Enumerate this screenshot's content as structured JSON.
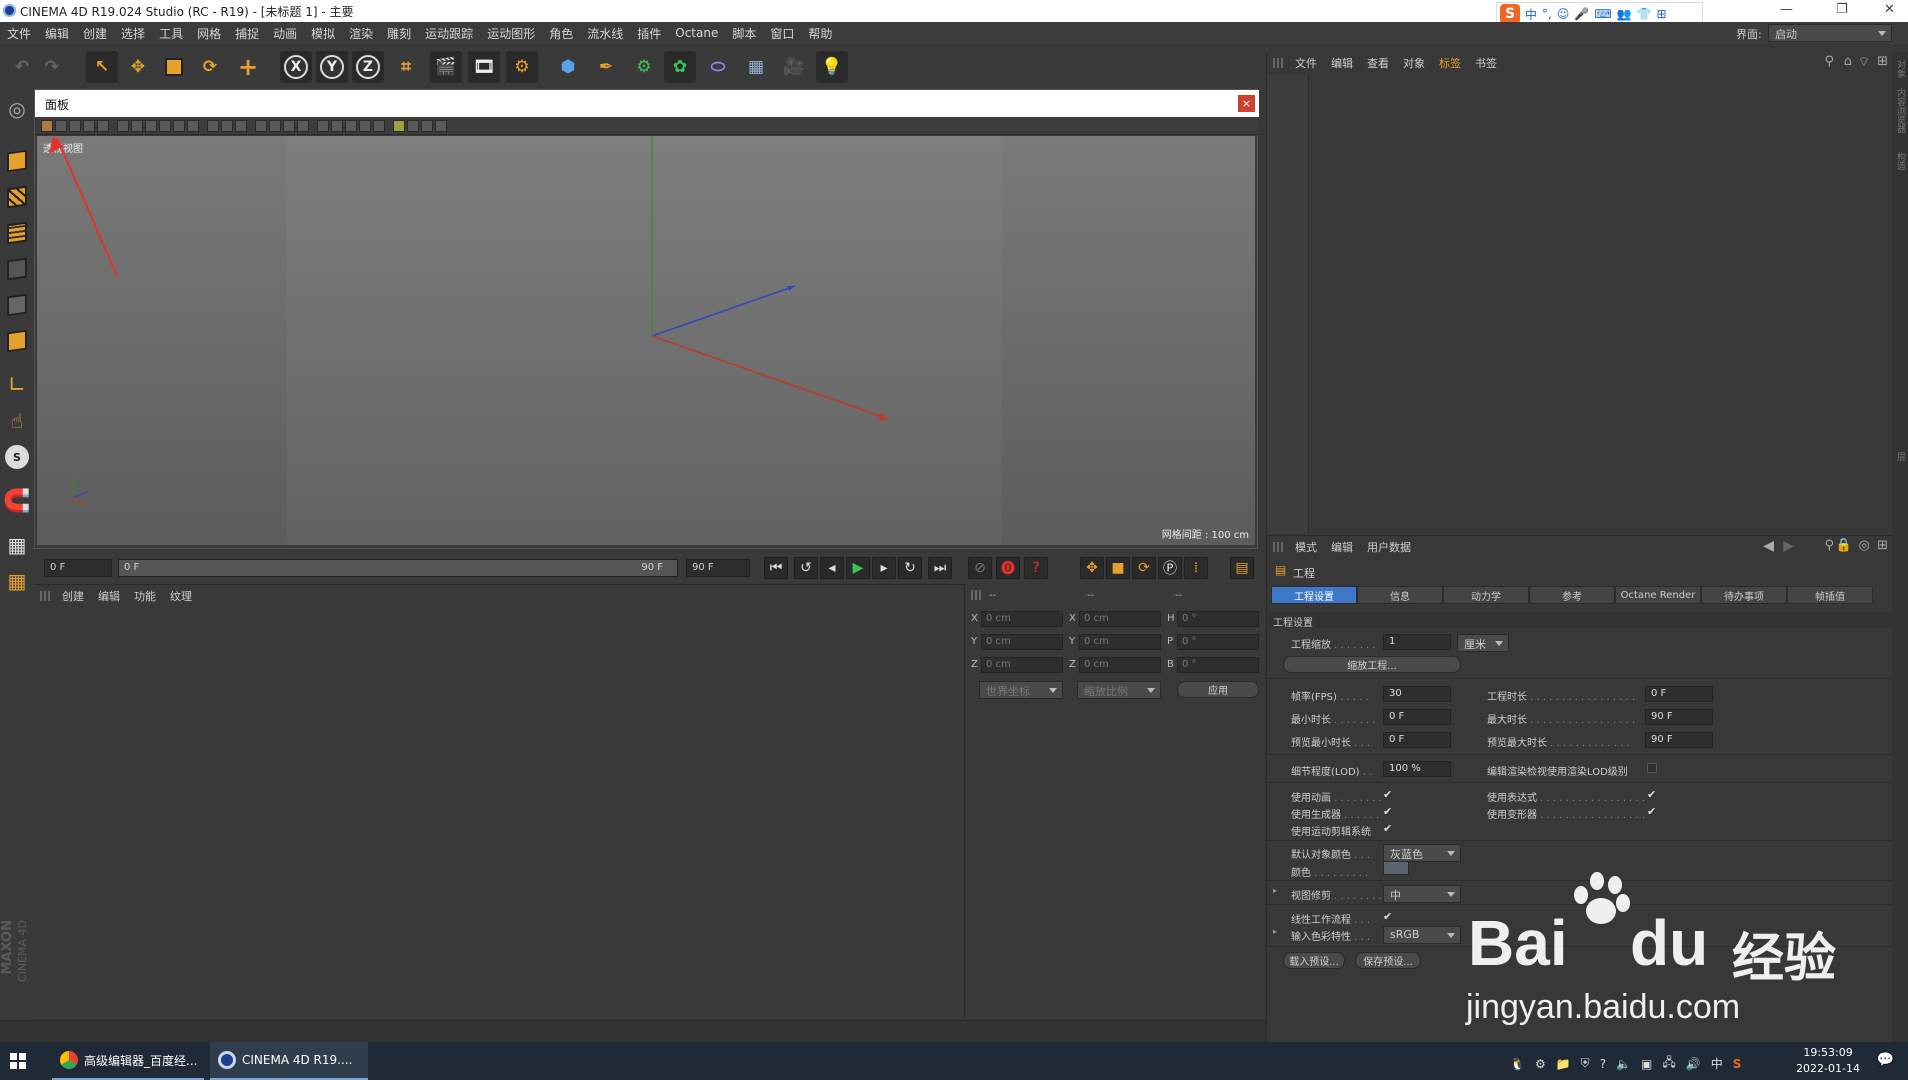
{
  "window": {
    "title": "CINEMA 4D R19.024 Studio (RC - R19) - [未标题 1] - 主要"
  },
  "ime": {
    "label": "中",
    "extras": "°,"
  },
  "menu": [
    "文件",
    "编辑",
    "创建",
    "选择",
    "工具",
    "网格",
    "捕捉",
    "动画",
    "模拟",
    "渲染",
    "雕刻",
    "运动跟踪",
    "运动图形",
    "角色",
    "流水线",
    "插件",
    "Octane",
    "脚本",
    "窗口",
    "帮助"
  ],
  "layout": {
    "label": "界面:",
    "value": "启动"
  },
  "toolbar": {
    "axis_x": "X",
    "axis_y": "Y",
    "axis_z": "Z"
  },
  "panel": {
    "title": "面板",
    "close": "×",
    "view_label": "透视视图",
    "grid_spacing": "网格间距 : 100 cm"
  },
  "timeline": {
    "current": "0 F",
    "start": "0 F",
    "end_inner": "90 F",
    "end": "90 F"
  },
  "material": {
    "menu": [
      "创建",
      "编辑",
      "功能",
      "纹理"
    ]
  },
  "coords": {
    "head": [
      "--",
      "--",
      "--"
    ],
    "rows": [
      {
        "a": "X",
        "av": "0 cm",
        "b": "X",
        "bv": "0 cm",
        "c": "H",
        "cv": "0 °"
      },
      {
        "a": "Y",
        "av": "0 cm",
        "b": "Y",
        "bv": "0 cm",
        "c": "P",
        "cv": "0 °"
      },
      {
        "a": "Z",
        "av": "0 cm",
        "b": "Z",
        "bv": "0 cm",
        "c": "B",
        "cv": "0 °"
      }
    ],
    "world": "世界坐标",
    "scale": "缩放比例",
    "apply": "应用"
  },
  "objects": {
    "menu": [
      "文件",
      "编辑",
      "查看",
      "对象",
      "标签",
      "书签"
    ]
  },
  "attributes": {
    "menu": [
      "模式",
      "编辑",
      "用户数据"
    ],
    "title": "工程",
    "tabs": [
      "工程设置",
      "信息",
      "动力学",
      "参考",
      "Octane Render",
      "待办事项",
      "帧插值"
    ],
    "section": "工程设置",
    "scale_label": "工程缩放",
    "scale_value": "1",
    "scale_unit": "厘米",
    "scale_btn": "缩放工程...",
    "fps_label": "帧率(FPS)",
    "fps": "30",
    "time_label": "工程时长",
    "time": "0 F",
    "min_label": "最小时长",
    "min": "0 F",
    "max_label": "最大时长",
    "max": "90 F",
    "pmin_label": "预览最小时长",
    "pmin": "0 F",
    "pmax_label": "预览最大时长",
    "pmax": "90 F",
    "lod_label": "细节程度(LOD)",
    "lod": "100 %",
    "lod_render_label": "编辑渲染检视使用渲染LOD级别",
    "anim_label": "使用动画",
    "expr_label": "使用表达式",
    "gen_label": "使用生成器",
    "deform_label": "使用变形器",
    "motion_label": "使用运动剪辑系统",
    "defcolor_label": "默认对象颜色",
    "defcolor": "灰蓝色",
    "color_label": "颜色",
    "clip_label": "视图修剪",
    "clip": "中",
    "linear_label": "线性工作流程",
    "input_label": "输入色彩特性",
    "input": "sRGB",
    "load": "载入预设...",
    "save": "保存预设..."
  },
  "side_tabs": [
    "对象",
    "内容浏览器",
    "构造",
    "层"
  ],
  "brand": {
    "line1": "MAXON",
    "line2": "CINEMA 4D"
  },
  "taskbar": {
    "app1": "高级编辑器_百度经...",
    "app2": "CINEMA 4D R19....",
    "lang": "中",
    "time": "19:53:09",
    "date": "2022-01-14"
  },
  "watermark": {
    "brand": "Bai",
    "brand2": "du",
    "cn": "经验",
    "url": "jingyan.baidu.com"
  },
  "colors": {
    "accent": "#3e79c9",
    "arrow": "#e5322b",
    "tool_orange": "#e5a02d",
    "axis_x": "#c0392b",
    "axis_y": "#2f8a2f",
    "axis_z": "#3646b8"
  }
}
